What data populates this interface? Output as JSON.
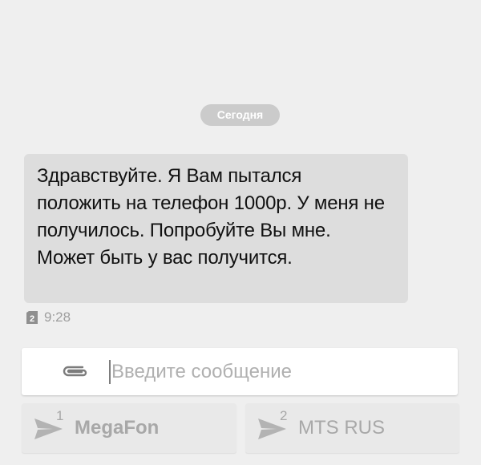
{
  "conversation": {
    "date_label": "Сегодня",
    "messages": [
      {
        "text": "Здравствуйте. Я Вам пытался положить на телефон 1000р. У меня не получилось. Попробуйте Вы мне. Может быть у вас получится.",
        "time": "9:28",
        "sim_badge": "2"
      }
    ]
  },
  "composer": {
    "placeholder": "Введите сообщение",
    "attach_icon": "paperclip-icon"
  },
  "send_buttons": [
    {
      "sim": "1",
      "carrier": "MegaFon",
      "icon": "send-icon"
    },
    {
      "sim": "2",
      "carrier": "MTS RUS",
      "icon": "send-icon"
    }
  ],
  "colors": {
    "background": "#efefef",
    "bubble": "#dddddd",
    "chip": "#cbcbcb",
    "muted_text": "#a8a8a8"
  }
}
